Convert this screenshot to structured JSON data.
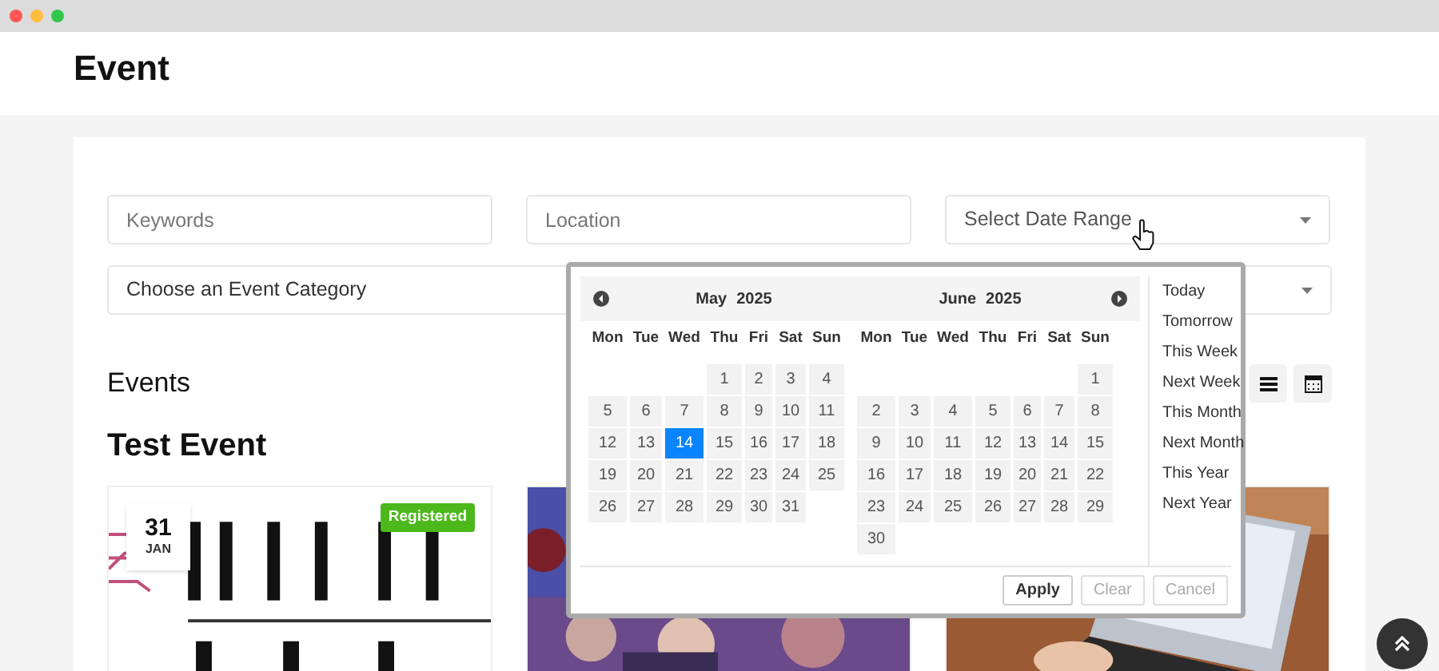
{
  "page": {
    "title": "Event"
  },
  "filters": {
    "keywords": {
      "placeholder": "Keywords"
    },
    "location": {
      "placeholder": "Location"
    },
    "date_range": {
      "placeholder": "Select Date Range"
    },
    "category": {
      "value": "Choose an Event Category"
    }
  },
  "events_heading": "Events",
  "view_buttons": [
    {
      "kind": "list",
      "selected": false
    },
    {
      "kind": "calendar",
      "selected": false
    }
  ],
  "group_title": "Test Event",
  "cards": [
    {
      "kind": "picture",
      "date_day": "31",
      "date_month": "JAN",
      "badge": "Registered"
    },
    {
      "kind": "picture"
    },
    {
      "kind": "picture"
    }
  ],
  "date_picker": {
    "months": [
      {
        "month": "May",
        "year": "2025",
        "weekdays": [
          "Mon",
          "Tue",
          "Wed",
          "Thu",
          "Fri",
          "Sat",
          "Sun"
        ],
        "weeks": [
          {
            "kind": "lead",
            "days": [
              {
                "day": "1",
                "selected": false
              },
              {
                "day": "2",
                "selected": false
              },
              {
                "day": "3",
                "selected": false
              },
              {
                "day": "4",
                "selected": false
              }
            ]
          },
          {
            "kind": "full",
            "days": [
              {
                "day": "5",
                "selected": false
              },
              {
                "day": "6",
                "selected": false
              },
              {
                "day": "7",
                "selected": false
              },
              {
                "day": "8",
                "selected": false
              },
              {
                "day": "9",
                "selected": false
              },
              {
                "day": "10",
                "selected": false
              },
              {
                "day": "11",
                "selected": false
              }
            ]
          },
          {
            "kind": "full",
            "days": [
              {
                "day": "12",
                "selected": false
              },
              {
                "day": "13",
                "selected": false
              },
              {
                "day": "14",
                "selected": true
              },
              {
                "day": "15",
                "selected": false
              },
              {
                "day": "16",
                "selected": false
              },
              {
                "day": "17",
                "selected": false
              },
              {
                "day": "18",
                "selected": false
              }
            ]
          },
          {
            "kind": "full",
            "days": [
              {
                "day": "19",
                "selected": false
              },
              {
                "day": "20",
                "selected": false
              },
              {
                "day": "21",
                "selected": false
              },
              {
                "day": "22",
                "selected": false
              },
              {
                "day": "23",
                "selected": false
              },
              {
                "day": "24",
                "selected": false
              },
              {
                "day": "25",
                "selected": false
              }
            ]
          },
          {
            "kind": "trail",
            "days": [
              {
                "day": "26",
                "selected": false
              },
              {
                "day": "27",
                "selected": false
              },
              {
                "day": "28",
                "selected": false
              },
              {
                "day": "29",
                "selected": false
              },
              {
                "day": "30",
                "selected": false
              },
              {
                "day": "31",
                "selected": false
              }
            ]
          }
        ]
      },
      {
        "month": "June",
        "year": "2025",
        "weekdays": [
          "Mon",
          "Tue",
          "Wed",
          "Thu",
          "Fri",
          "Sat",
          "Sun"
        ],
        "weeks": [
          {
            "kind": "lead",
            "days": [
              {
                "day": "1",
                "selected": false
              }
            ]
          },
          {
            "kind": "full",
            "days": [
              {
                "day": "2",
                "selected": false
              },
              {
                "day": "3",
                "selected": false
              },
              {
                "day": "4",
                "selected": false
              },
              {
                "day": "5",
                "selected": false
              },
              {
                "day": "6",
                "selected": false
              },
              {
                "day": "7",
                "selected": false
              },
              {
                "day": "8",
                "selected": false
              }
            ]
          },
          {
            "kind": "full",
            "days": [
              {
                "day": "9",
                "selected": false
              },
              {
                "day": "10",
                "selected": false
              },
              {
                "day": "11",
                "selected": false
              },
              {
                "day": "12",
                "selected": false
              },
              {
                "day": "13",
                "selected": false
              },
              {
                "day": "14",
                "selected": false
              },
              {
                "day": "15",
                "selected": false
              }
            ]
          },
          {
            "kind": "full",
            "days": [
              {
                "day": "16",
                "selected": false
              },
              {
                "day": "17",
                "selected": false
              },
              {
                "day": "18",
                "selected": false
              },
              {
                "day": "19",
                "selected": false
              },
              {
                "day": "20",
                "selected": false
              },
              {
                "day": "21",
                "selected": false
              },
              {
                "day": "22",
                "selected": false
              }
            ]
          },
          {
            "kind": "full",
            "days": [
              {
                "day": "23",
                "selected": false
              },
              {
                "day": "24",
                "selected": false
              },
              {
                "day": "25",
                "selected": false
              },
              {
                "day": "26",
                "selected": false
              },
              {
                "day": "27",
                "selected": false
              },
              {
                "day": "28",
                "selected": false
              },
              {
                "day": "29",
                "selected": false
              }
            ]
          },
          {
            "kind": "trail",
            "days": [
              {
                "day": "30",
                "selected": false
              }
            ]
          }
        ]
      }
    ],
    "ranges": [
      "Today",
      "Tomorrow",
      "This Week",
      "Next Week",
      "This Month",
      "Next Month",
      "This Year",
      "Next Year"
    ],
    "buttons": [
      {
        "label": "Apply",
        "disabled": false
      },
      {
        "label": "Clear",
        "disabled": true
      },
      {
        "label": "Cancel",
        "disabled": true
      }
    ]
  }
}
